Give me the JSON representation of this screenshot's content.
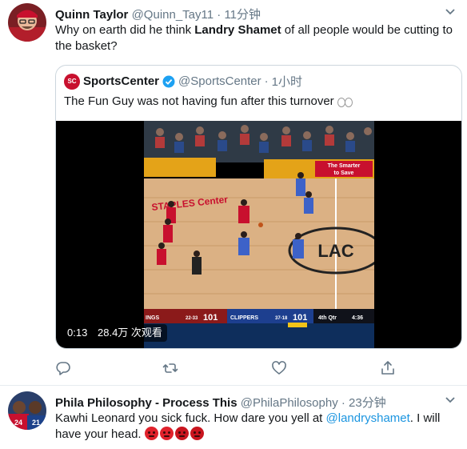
{
  "tweet1": {
    "name": "Quinn Taylor",
    "handle": "@Quinn_Tay11",
    "separator": "·",
    "time": "11分钟",
    "text_pre": "Why on earth did he think ",
    "text_bold": "Landry Shamet",
    "text_post": " of all people would be cutting to the basket?",
    "quote": {
      "logo_text": "SC",
      "name": "SportsCenter",
      "handle": "@SportsCenter",
      "separator": "·",
      "time": "1小时",
      "text": "The Fun Guy was not having fun after this turnover",
      "video": {
        "duration": "0:13",
        "views": "28.4万 次观看",
        "scoreboard": {
          "left_team_fragment": "INGS",
          "left_record": "22-33",
          "left_score": "101",
          "right_team": "CLIPPERS",
          "right_record": "37-18",
          "right_score": "101",
          "quarter": "4th Qtr",
          "clock": "4:36"
        },
        "court_sign": "STAPLES Center",
        "ad_line1": "The Smarter",
        "ad_line2": "to Save",
        "center_logo": "LAC"
      }
    },
    "actions": [
      "reply-icon",
      "retweet-icon",
      "like-icon",
      "share-icon"
    ]
  },
  "tweet2": {
    "name": "Phila Philosophy - Process This",
    "handle": "@PhilaPhilosophy",
    "separator": "·",
    "time": "23分钟",
    "text_pre": "Kawhi Leonard you sick fuck. How dare you yell at ",
    "mention": "@landryshamet",
    "text_post": ". I will have your head.",
    "emoji_count": 4
  },
  "colors": {
    "link": "#1b95e0",
    "secondary": "#657786",
    "border": "#e6ecf0",
    "quote_border": "#ccd6dd"
  }
}
